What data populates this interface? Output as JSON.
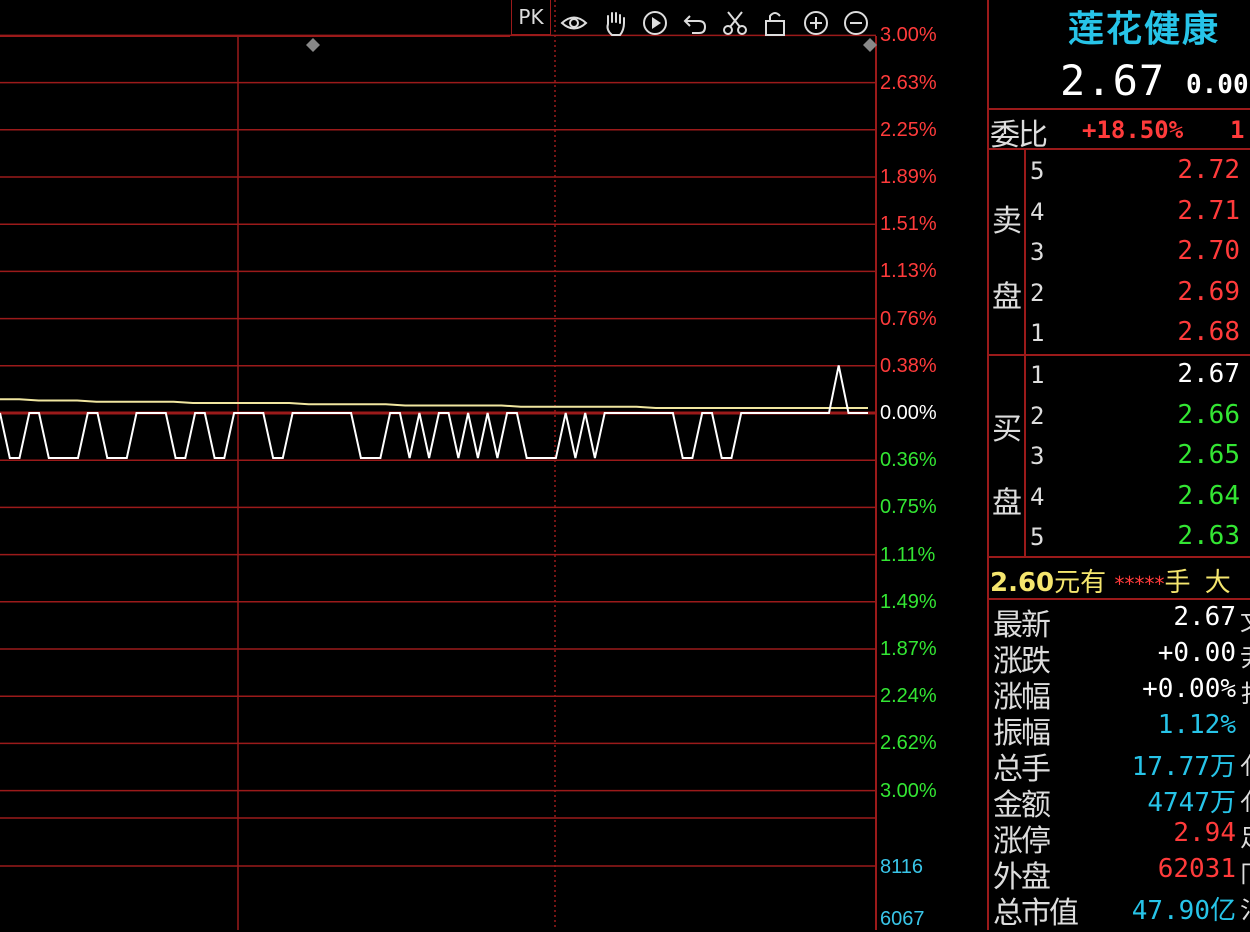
{
  "toolbar": {
    "pk_label": "PK",
    "icons": [
      "eye-icon",
      "hand-icon",
      "play-icon",
      "undo-icon",
      "scissors-icon",
      "lock-icon",
      "zoom-in-icon",
      "zoom-out-icon"
    ]
  },
  "colors": {
    "up": "#ff3b3b",
    "down": "#33e633",
    "neutral": "#ffffff",
    "cyan": "#27c4e8",
    "grid": "#9b1a1a",
    "avg_line": "#f0e6a0",
    "yellow": "#f5e66e"
  },
  "chart_data": {
    "type": "line",
    "y_axis_labels_up": [
      "3.00%",
      "2.63%",
      "2.25%",
      "1.89%",
      "1.51%",
      "1.13%",
      "0.76%",
      "0.38%"
    ],
    "y_axis_zero": "0.00%",
    "y_axis_labels_down": [
      "0.36%",
      "0.75%",
      "1.11%",
      "1.49%",
      "1.87%",
      "2.24%",
      "2.62%",
      "3.00%"
    ],
    "ylim_percent": [
      -3.0,
      3.0
    ],
    "series": [
      {
        "values": [
          0,
          -0.36,
          -0.36,
          0,
          0,
          -0.36,
          -0.36,
          -0.36,
          -0.36,
          0,
          0,
          -0.36,
          -0.36,
          -0.36,
          0,
          0,
          0,
          0,
          -0.36,
          -0.36,
          0,
          0,
          -0.36,
          -0.36,
          0,
          0,
          0,
          0,
          -0.36,
          -0.36,
          0,
          0,
          0,
          0,
          0,
          0,
          0,
          -0.36,
          -0.36,
          -0.36,
          0,
          0,
          -0.36,
          0,
          -0.36,
          0,
          0,
          -0.36,
          0,
          -0.36,
          0,
          -0.36,
          0,
          0,
          -0.36,
          -0.36,
          -0.36,
          -0.36,
          0,
          -0.36,
          0,
          -0.36,
          0,
          0,
          0,
          0,
          0,
          0,
          0,
          0,
          -0.36,
          -0.36,
          0,
          0,
          -0.36,
          -0.36,
          0,
          0,
          0,
          0,
          0,
          0,
          0,
          0,
          0,
          0,
          0.38,
          0,
          0,
          0
        ]
      },
      {
        "values": [
          0.11,
          0.11,
          0.1,
          0.1,
          0.1,
          0.09,
          0.09,
          0.09,
          0.09,
          0.09,
          0.08,
          0.08,
          0.08,
          0.08,
          0.08,
          0.08,
          0.07,
          0.07,
          0.07,
          0.07,
          0.07,
          0.06,
          0.06,
          0.06,
          0.06,
          0.06,
          0.06,
          0.05,
          0.05,
          0.05,
          0.05,
          0.05,
          0.05,
          0.05,
          0.04,
          0.04,
          0.04,
          0.04,
          0.04,
          0.04,
          0.04,
          0.04,
          0.04,
          0.04,
          0.04,
          0.04
        ]
      }
    ],
    "volume_axis_labels": [
      "8116",
      "6067"
    ]
  },
  "stock": {
    "name": "莲花健康",
    "price": "2.67",
    "change": "0.00"
  },
  "weibi": {
    "label": "委比",
    "value": "+18.50%",
    "extra": "1"
  },
  "order_book": {
    "sell_label_1": "卖",
    "sell_label_2": "盘",
    "buy_label_1": "买",
    "buy_label_2": "盘",
    "sell": [
      {
        "level": "5",
        "price": "2.72"
      },
      {
        "level": "4",
        "price": "2.71"
      },
      {
        "level": "3",
        "price": "2.70"
      },
      {
        "level": "2",
        "price": "2.69"
      },
      {
        "level": "1",
        "price": "2.68"
      }
    ],
    "buy": [
      {
        "level": "1",
        "price": "2.67"
      },
      {
        "level": "2",
        "price": "2.66"
      },
      {
        "level": "3",
        "price": "2.65"
      },
      {
        "level": "4",
        "price": "2.64"
      },
      {
        "level": "5",
        "price": "2.63"
      }
    ]
  },
  "big_order": {
    "price": "2.60",
    "text1": "元有",
    "stars": "*****",
    "text2": "手",
    "text3": "大"
  },
  "quotes": [
    {
      "label": "最新",
      "value": "2.67",
      "color": "#ffffff",
      "cut": "文"
    },
    {
      "label": "涨跌",
      "value": "+0.00",
      "color": "#ffffff",
      "cut": "尹"
    },
    {
      "label": "涨幅",
      "value": "+0.00%",
      "color": "#ffffff",
      "cut": "扌"
    },
    {
      "label": "振幅",
      "value": "1.12%",
      "color": "#27c4e8",
      "cut": ""
    },
    {
      "label": "总手",
      "value": "17.77万",
      "color": "#27c4e8",
      "cut": "亻"
    },
    {
      "label": "金额",
      "value": "4747万",
      "color": "#27c4e8",
      "cut": "亻"
    },
    {
      "label": "涨停",
      "value": "2.94",
      "color": "#ff3b3b",
      "cut": "足"
    },
    {
      "label": "外盘",
      "value": "62031",
      "color": "#ff3b3b",
      "cut": "冂"
    },
    {
      "label": "总市值",
      "value": "47.90亿",
      "color": "#27c4e8",
      "cut": "氵"
    }
  ]
}
